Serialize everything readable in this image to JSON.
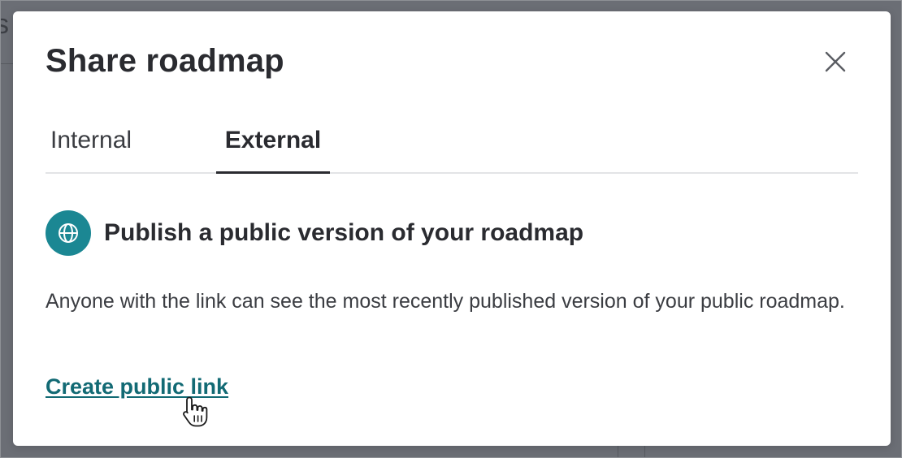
{
  "background": {
    "fragment_text": "s"
  },
  "modal": {
    "title": "Share roadmap",
    "close_icon": "close-icon",
    "tabs": [
      {
        "label": "Internal",
        "active": false
      },
      {
        "label": "External",
        "active": true
      }
    ],
    "section": {
      "icon": "globe-icon",
      "icon_color": "#1b8793",
      "heading": "Publish a public version of your roadmap"
    },
    "description": "Anyone with the link can see the most recently published version of your public roadmap.",
    "create_link_label": "Create public link",
    "link_color": "#126a74"
  },
  "cursor": {
    "icon": "hand-pointer-icon"
  }
}
